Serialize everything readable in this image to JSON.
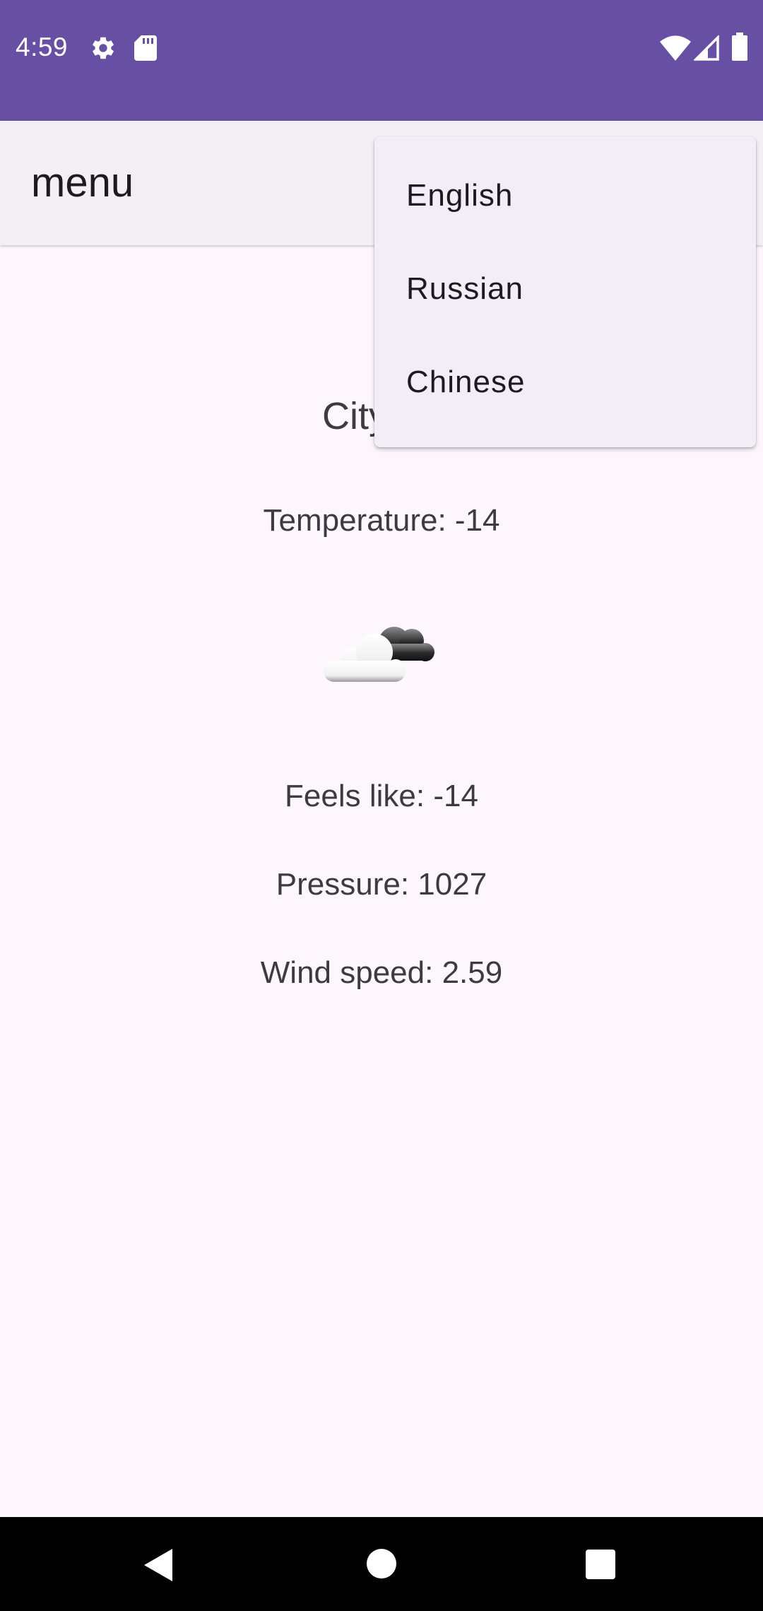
{
  "status_bar": {
    "time": "4:59",
    "icons": [
      "gear-icon",
      "sd-card-icon",
      "wifi-icon",
      "cell-signal-icon",
      "battery-icon"
    ],
    "color": "#6750a4"
  },
  "app_bar": {
    "title": "menu"
  },
  "weather": {
    "city": "City: M",
    "temperature": "Temperature: -14",
    "icon": "partly-cloudy-icon",
    "feels_like": "Feels like: -14",
    "pressure": "Pressure: 1027",
    "wind_speed": "Wind speed: 2.59"
  },
  "language_menu": {
    "items": [
      {
        "label": "English"
      },
      {
        "label": "Russian"
      },
      {
        "label": "Chinese"
      }
    ]
  },
  "nav_bar": {
    "buttons": [
      "back-icon",
      "home-icon",
      "recents-icon"
    ]
  }
}
